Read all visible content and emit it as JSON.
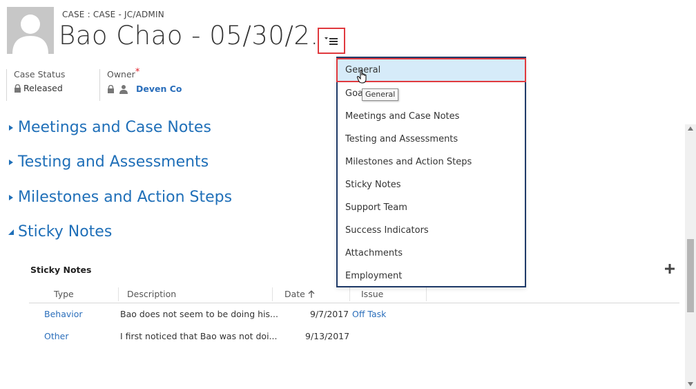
{
  "header": {
    "breadcrumb": "CASE : CASE - JC/ADMIN",
    "title": "Bao Chao - 05/30/2...",
    "avatar_icon": "person-silhouette-icon",
    "nav_button_icon": "menu-list-icon"
  },
  "fields": {
    "case_status": {
      "label": "Case Status",
      "value": "Released",
      "icon": "lock-icon"
    },
    "owner": {
      "label": "Owner",
      "required_mark": "*",
      "value": "Deven Co",
      "icons": [
        "lock-icon",
        "user-icon"
      ]
    }
  },
  "sections": [
    {
      "label": "Meetings and Case Notes",
      "expanded": false
    },
    {
      "label": "Testing and Assessments",
      "expanded": false
    },
    {
      "label": "Milestones and Action Steps",
      "expanded": false
    },
    {
      "label": "Sticky Notes",
      "expanded": true
    }
  ],
  "sticky_notes": {
    "title": "Sticky Notes",
    "columns": [
      "Type",
      "Description",
      "Date",
      "Issue"
    ],
    "sort_column": "Date",
    "rows": [
      {
        "type": "Behavior",
        "description": "Bao does not seem to be doing his...",
        "date": "9/7/2017",
        "issue": "Off Task"
      },
      {
        "type": "Other",
        "description": "I first noticed that Bao was not doi...",
        "date": "9/13/2017",
        "issue": ""
      }
    ]
  },
  "nav_menu": {
    "items": [
      "General",
      "Goa",
      "Meetings and Case Notes",
      "Testing and Assessments",
      "Milestones and Action Steps",
      "Sticky Notes",
      "Support Team",
      "Success Indicators",
      "Attachments",
      "Employment"
    ],
    "selected": "General",
    "tooltip": "General"
  },
  "colors": {
    "accent": "#1f6fb8",
    "link": "#2a6ebb",
    "highlight_border": "#e0393e",
    "selected_bg": "#d6ebf9",
    "required": "#e0202a"
  }
}
